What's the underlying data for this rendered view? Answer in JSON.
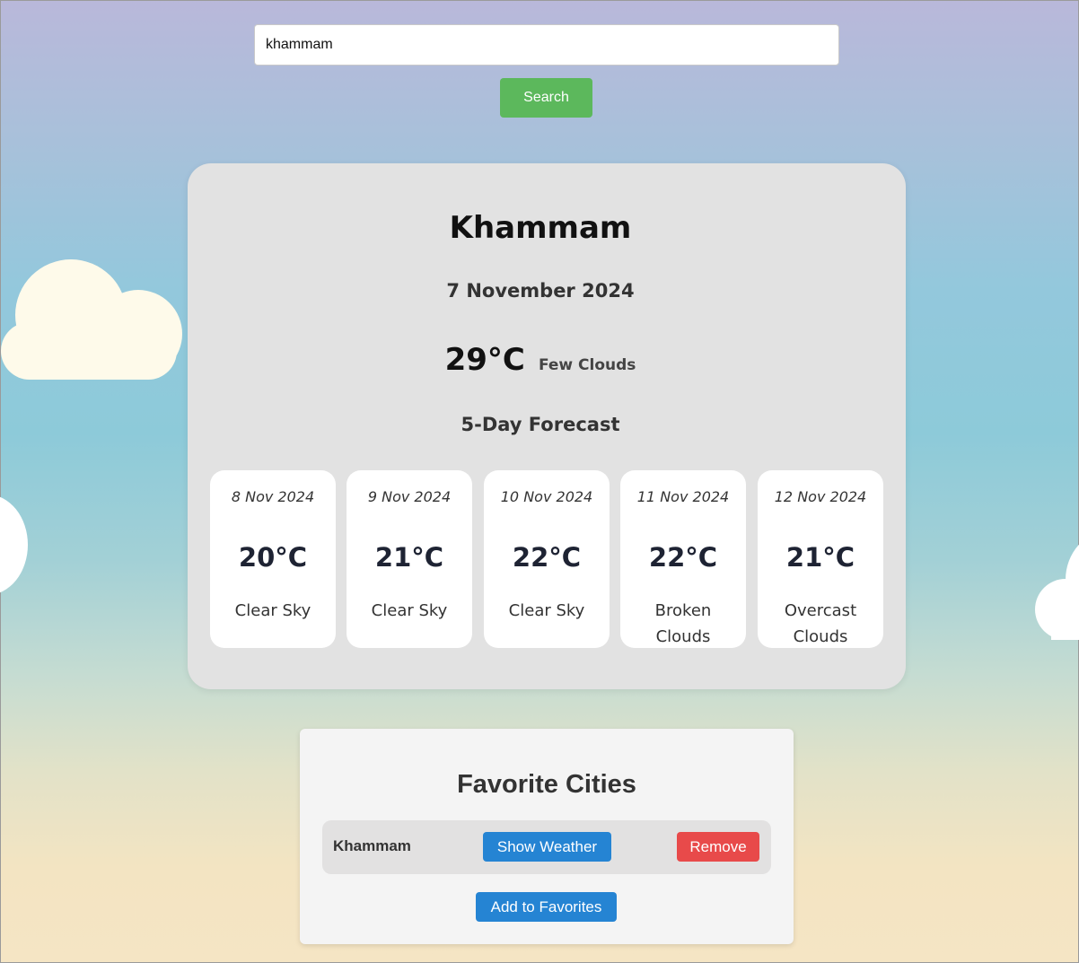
{
  "search": {
    "value": "khammam",
    "button_label": "Search"
  },
  "current": {
    "city": "Khammam",
    "date": "7 November 2024",
    "temperature": "29°C",
    "description": "Few Clouds"
  },
  "forecast": {
    "title": "5-Day Forecast",
    "days": [
      {
        "date": "8 Nov 2024",
        "temp": "20°C",
        "desc": "Clear Sky"
      },
      {
        "date": "9 Nov 2024",
        "temp": "21°C",
        "desc": "Clear Sky"
      },
      {
        "date": "10 Nov 2024",
        "temp": "22°C",
        "desc": "Clear Sky"
      },
      {
        "date": "11 Nov 2024",
        "temp": "22°C",
        "desc": "Broken Clouds"
      },
      {
        "date": "12 Nov 2024",
        "temp": "21°C",
        "desc": "Overcast Clouds"
      }
    ]
  },
  "favorites": {
    "title": "Favorite Cities",
    "items": [
      {
        "city": "Khammam",
        "show_label": "Show Weather",
        "remove_label": "Remove"
      }
    ],
    "add_label": "Add to Favorites"
  },
  "colors": {
    "search_button": "#5cb85c",
    "primary_button": "#2584d3",
    "danger_button": "#e84a4a",
    "card_background": "#e2e2e2"
  }
}
